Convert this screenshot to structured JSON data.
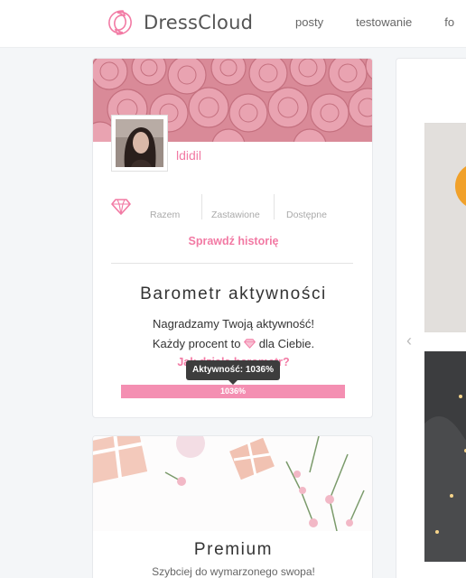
{
  "header": {
    "brand": "DressCloud",
    "nav": [
      "posty",
      "testowanie",
      "fo"
    ]
  },
  "profile": {
    "username": "ldidil",
    "stats_labels": [
      "Razem",
      "Zastawione",
      "Dostępne"
    ],
    "history_link": "Sprawdź historię"
  },
  "barometer": {
    "title": "Barometr aktywności",
    "line1": "Nagradzamy Twoją aktywność!",
    "line2_before": "Każdy procent to",
    "line2_after": "dla Ciebie.",
    "how_link": "Jak działa barometr?",
    "tooltip": "Aktywność: 1036%",
    "progress_label": "1036%",
    "progress_fill_fraction": 1.0
  },
  "premium": {
    "title": "Premium",
    "subtitle": "Szybciej do wymarzonego swopa!"
  },
  "colors": {
    "accent": "#f27aa4",
    "progress": "#f48fb2"
  },
  "icons": {
    "logo": "dresscloud-logo-icon",
    "gem": "diamond-icon",
    "carousel_prev": "chevron-left-icon"
  }
}
